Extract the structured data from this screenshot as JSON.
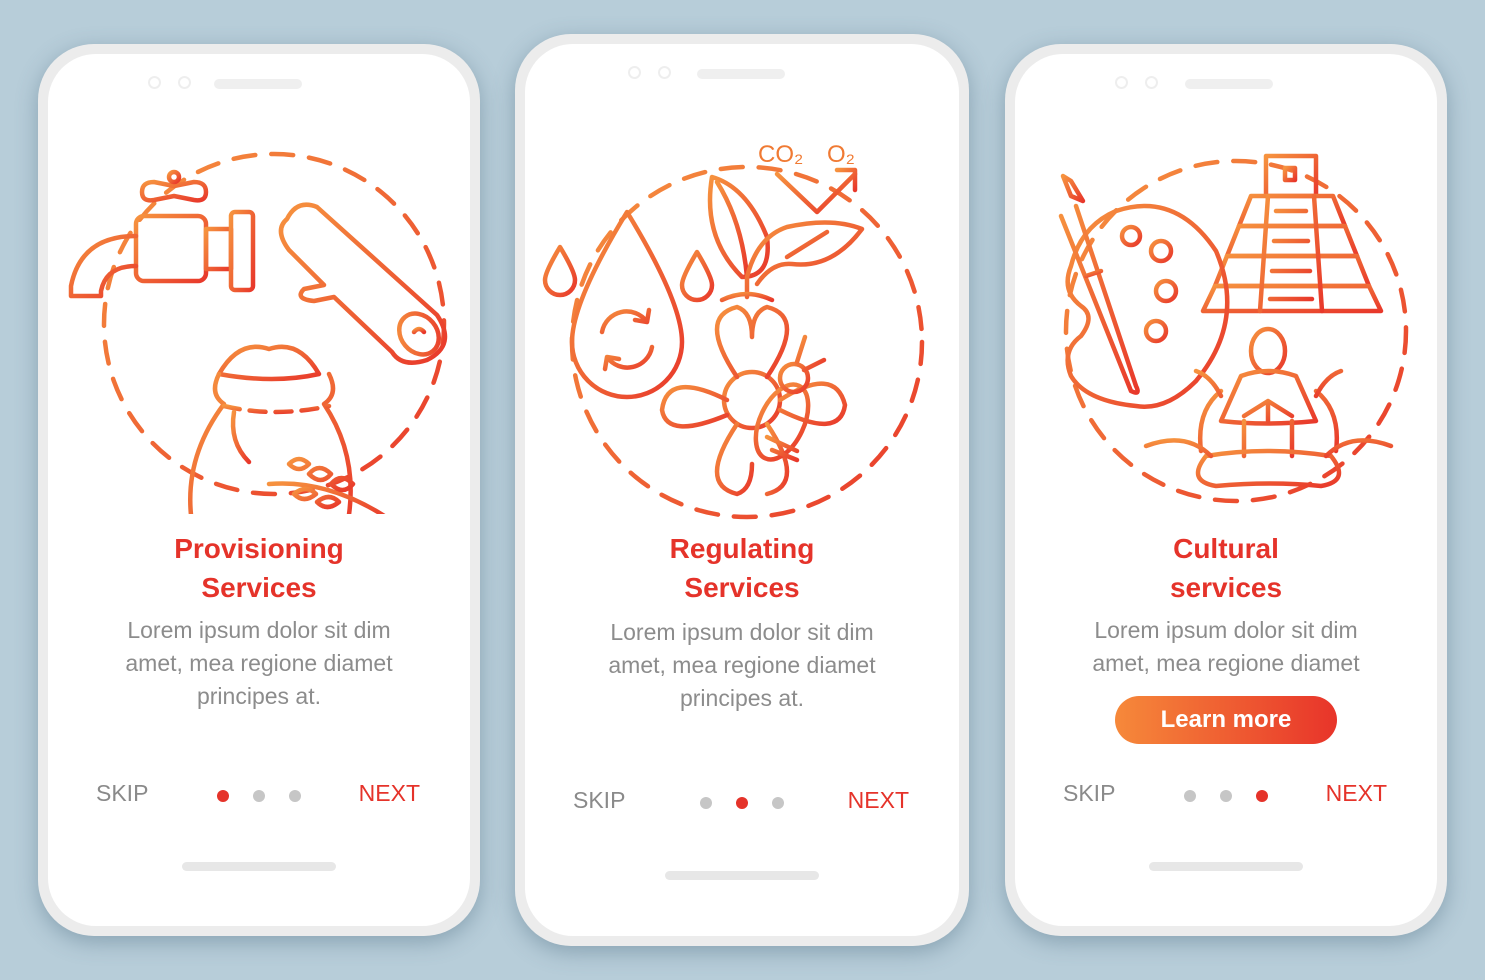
{
  "colors": {
    "background": "#b7cdd9",
    "accent_red": "#e5332a",
    "accent_orange": "#f6893a",
    "text_gray": "#8c8c8c",
    "dot_inactive": "#c6c6c6"
  },
  "screens": [
    {
      "illustration": [
        "water-tap-icon",
        "wood-log-icon",
        "grain-sack-icon",
        "wheat-icon"
      ],
      "title_line1": "Provisioning",
      "title_line2": "Services",
      "description": [
        "Lorem ipsum dolor sit dim",
        "amet, mea regione diamet",
        "principes at."
      ],
      "skip_label": "SKIP",
      "next_label": "NEXT",
      "page_indicator": {
        "current": 1,
        "total": 3
      }
    },
    {
      "illustration": [
        "water-cycle-drop-icon",
        "plant-sprout-icon",
        "flower-icon",
        "bee-icon"
      ],
      "co2_label": "CO₂",
      "o2_label": "O₂",
      "title_line1": "Regulating",
      "title_line2": "Services",
      "description": [
        "Lorem ipsum dolor sit dim",
        "amet, mea regione diamet",
        "principes at."
      ],
      "skip_label": "SKIP",
      "next_label": "NEXT",
      "page_indicator": {
        "current": 2,
        "total": 3
      }
    },
    {
      "illustration": [
        "art-palette-icon",
        "pyramid-icon",
        "meditation-lotus-icon"
      ],
      "title_line1": "Cultural",
      "title_line2": "services",
      "description": [
        "Lorem ipsum dolor sit dim",
        "amet, mea regione diamet"
      ],
      "cta_label": "Learn more",
      "skip_label": "SKIP",
      "next_label": "NEXT",
      "page_indicator": {
        "current": 3,
        "total": 3
      }
    }
  ]
}
